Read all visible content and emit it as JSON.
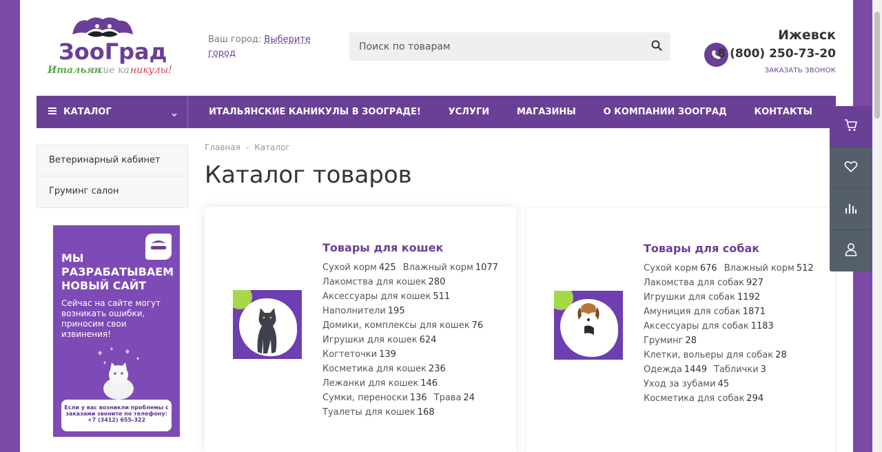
{
  "header": {
    "logo_text": "ЗооГрад",
    "logo_tagline": "Итальянские каникулы!",
    "city_prompt": "Ваш город:",
    "city_select": "Выберите город",
    "search_placeholder": "Поиск по товарам",
    "city": "Ижевск",
    "phone": "8 (800) 250-73-20",
    "callback": "ЗАКАЗАТЬ ЗВОНОК"
  },
  "nav": {
    "catalog": "КАТАЛОГ",
    "items": [
      "ИТАЛЬЯНСКИЕ КАНИКУЛЫ В ЗООГРАДЕ!",
      "УСЛУГИ",
      "МАГАЗИНЫ",
      "О КОМПАНИИ ЗООГРАД",
      "КОНТАКТЫ"
    ]
  },
  "sidebar": {
    "items": [
      "Ветеринарный кабинет",
      "Груминг салон"
    ]
  },
  "banner": {
    "title": "МЫ РАЗРАБАТЫВАЕМ НОВЫЙ САЙТ",
    "text": "Сейчас на сайте могут возникать ошибки, приносим свои извинения!",
    "note": "Если у вас возникли проблемы с заказами звоните по телефону: +7 (3412) 655-322"
  },
  "breadcrumbs": [
    "Главная",
    "Каталог"
  ],
  "page_title": "Каталог товаров",
  "cards": [
    {
      "title": "Товары для кошек",
      "rows": [
        [
          {
            "name": "Сухой корм",
            "count": "425"
          },
          {
            "name": "Влажный корм",
            "count": "1077"
          }
        ],
        [
          {
            "name": "Лакомства для кошек",
            "count": "280"
          }
        ],
        [
          {
            "name": "Аксессуары для кошек",
            "count": "511"
          }
        ],
        [
          {
            "name": "Наполнители",
            "count": "195"
          }
        ],
        [
          {
            "name": "Домики, комплексы для кошек",
            "count": "76"
          }
        ],
        [
          {
            "name": "Игрушки для кошек",
            "count": "624"
          }
        ],
        [
          {
            "name": "Когтеточки",
            "count": "139"
          }
        ],
        [
          {
            "name": "Косметика для кошек",
            "count": "236"
          }
        ],
        [
          {
            "name": "Лежанки для кошек",
            "count": "146"
          }
        ],
        [
          {
            "name": "Сумки, переноски",
            "count": "136"
          },
          {
            "name": "Трава",
            "count": "24"
          }
        ],
        [
          {
            "name": "Туалеты для кошек",
            "count": "168"
          }
        ]
      ]
    },
    {
      "title": "Товары для собак",
      "rows": [
        [
          {
            "name": "Сухой корм",
            "count": "676"
          },
          {
            "name": "Влажный корм",
            "count": "512"
          }
        ],
        [
          {
            "name": "Лакомства для собак",
            "count": "927"
          }
        ],
        [
          {
            "name": "Игрушки для собак",
            "count": "1192"
          }
        ],
        [
          {
            "name": "Амуниция для собак",
            "count": "1871"
          }
        ],
        [
          {
            "name": "Аксессуары для собак",
            "count": "1183"
          }
        ],
        [
          {
            "name": "Груминг",
            "count": "28"
          }
        ],
        [
          {
            "name": "Клетки, вольеры для собак",
            "count": "28"
          }
        ],
        [
          {
            "name": "Одежда",
            "count": "1449"
          },
          {
            "name": "Таблички",
            "count": "3"
          }
        ],
        [
          {
            "name": "Уход за зубами",
            "count": "45"
          }
        ],
        [
          {
            "name": "Косметика для собак",
            "count": "294"
          }
        ]
      ]
    }
  ],
  "tools": [
    "cart-icon",
    "heart-icon",
    "compare-icon",
    "user-icon"
  ],
  "colors": {
    "brand": "#6a3f96",
    "accent_green": "#a6d84a",
    "tools_bg": "#555e6b"
  }
}
